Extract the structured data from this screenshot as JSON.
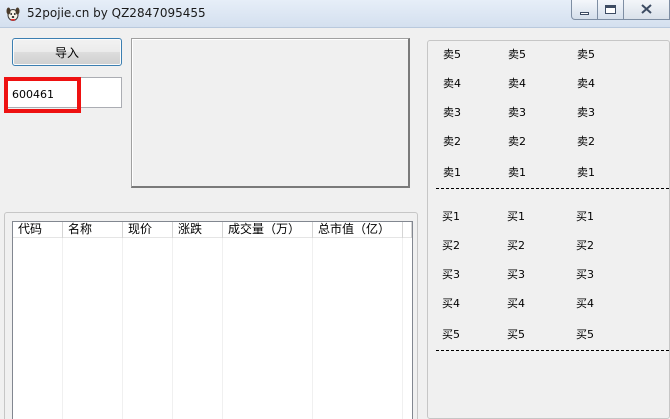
{
  "window": {
    "title": "52pojie.cn by QZ2847095455"
  },
  "toolbar": {
    "import_label": "导入"
  },
  "code_input": {
    "value": "600461"
  },
  "table": {
    "columns": [
      "代码",
      "名称",
      "现价",
      "涨跌",
      "成交量（万）",
      "总市值（亿）"
    ],
    "rows": []
  },
  "quotes": {
    "sell": [
      [
        "卖5",
        "卖5",
        "卖5"
      ],
      [
        "卖4",
        "卖4",
        "卖4"
      ],
      [
        "卖3",
        "卖3",
        "卖3"
      ],
      [
        "卖2",
        "卖2",
        "卖2"
      ],
      [
        "卖1",
        "卖1",
        "卖1"
      ]
    ],
    "buy": [
      [
        "买1",
        "买1",
        "买1"
      ],
      [
        "买2",
        "买2",
        "买2"
      ],
      [
        "买3",
        "买3",
        "买3"
      ],
      [
        "买4",
        "买4",
        "买4"
      ],
      [
        "买5",
        "买5",
        "买5"
      ]
    ]
  },
  "colors": {
    "highlight": "#ee1111",
    "button_border": "#3c7fb1"
  },
  "icons": {
    "app": "dog-icon",
    "minimize": "minimize-icon",
    "maximize": "maximize-icon",
    "close": "close-icon"
  }
}
